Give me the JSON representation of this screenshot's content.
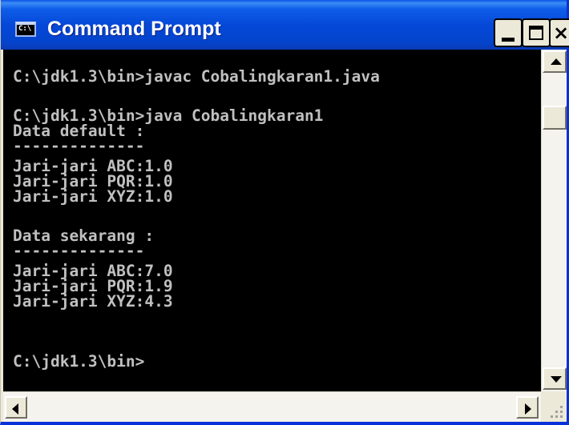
{
  "window": {
    "title": "Command Prompt",
    "app_icon_text": "C:\\",
    "colors": {
      "titlebar": "#0548d8",
      "console_bg": "#000000",
      "console_fg": "#c0c0c0"
    }
  },
  "titlebar_buttons": {
    "minimize_glyph": "_",
    "maximize_glyph": "□",
    "close_glyph": "×"
  },
  "console": {
    "lines": [
      "C:\\jdk1.3\\bin>javac Cobalingkaran1.java",
      "C:\\jdk1.3\\bin>java Cobalingkaran1",
      "Data default :",
      "--------------",
      "Jari-jari ABC:1.0",
      "Jari-jari PQR:1.0",
      "Jari-jari XYZ:1.0",
      "Data sekarang :",
      "--------------",
      "Jari-jari ABC:7.0",
      "Jari-jari PQR:1.9",
      "Jari-jari XYZ:4.3",
      "C:\\jdk1.3\\bin>"
    ]
  },
  "scrollbars": {
    "vertical_icons": [
      "scroll-up-arrow-icon",
      "scroll-down-arrow-icon"
    ],
    "horizontal_icons": [
      "scroll-left-arrow-icon",
      "scroll-right-arrow-icon"
    ]
  }
}
